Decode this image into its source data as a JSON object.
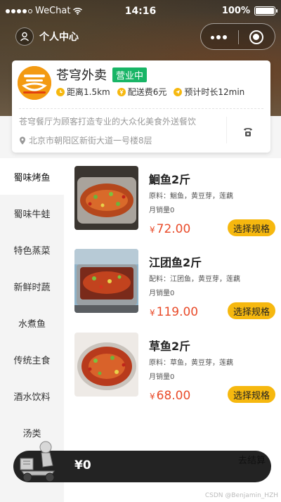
{
  "status_bar": {
    "carrier": "WeChat",
    "time": "14:16",
    "battery": "100%"
  },
  "nav": {
    "profile_label": "个人中心"
  },
  "shop": {
    "name": "苍穹外卖",
    "status": "营业中",
    "distance": "距离1.5km",
    "delivery_fee": "配送费6元",
    "eta": "预计时长12min",
    "description": "苍穹餐厅为顾客打造专业的大众化美食外送餐饮",
    "address": "北京市朝阳区新街大道一号楼8层"
  },
  "categories": [
    {
      "label": "蜀味烤鱼",
      "active": true
    },
    {
      "label": "蜀味牛蛙",
      "active": false
    },
    {
      "label": "特色蒸菜",
      "active": false
    },
    {
      "label": "新鲜时蔬",
      "active": false
    },
    {
      "label": "水煮鱼",
      "active": false
    },
    {
      "label": "传统主食",
      "active": false
    },
    {
      "label": "酒水饮料",
      "active": false
    },
    {
      "label": "汤类",
      "active": false
    }
  ],
  "dishes": [
    {
      "name": "鮰鱼2斤",
      "ingredients": "原料：鮰鱼，黄豆芽，莲藕",
      "sales": "月销量0",
      "price": "72.00",
      "button": "选择规格"
    },
    {
      "name": "江团鱼2斤",
      "ingredients": "配料：江团鱼，黄豆芽，莲藕",
      "sales": "月销量0",
      "price": "119.00",
      "button": "选择规格"
    },
    {
      "name": "草鱼2斤",
      "ingredients": "原料：草鱼，黄豆芽，莲藕",
      "sales": "月销量0",
      "price": "68.00",
      "button": "选择规格"
    }
  ],
  "price_symbol": "¥",
  "cart": {
    "total": "¥0",
    "checkout_label": "去结算"
  },
  "watermark": "CSDN @Benjamin_HZH",
  "colors": {
    "accent": "#f6b80f",
    "open_badge": "#18b566",
    "price": "#e94b2a",
    "cart_bar": "#232323"
  },
  "icons": [
    "signal-dots-icon",
    "wifi-icon",
    "battery-icon",
    "user-icon",
    "more-icon",
    "target-icon",
    "clock-icon",
    "yen-icon",
    "send-icon",
    "location-icon",
    "phone-icon",
    "delivery-rider-icon"
  ]
}
